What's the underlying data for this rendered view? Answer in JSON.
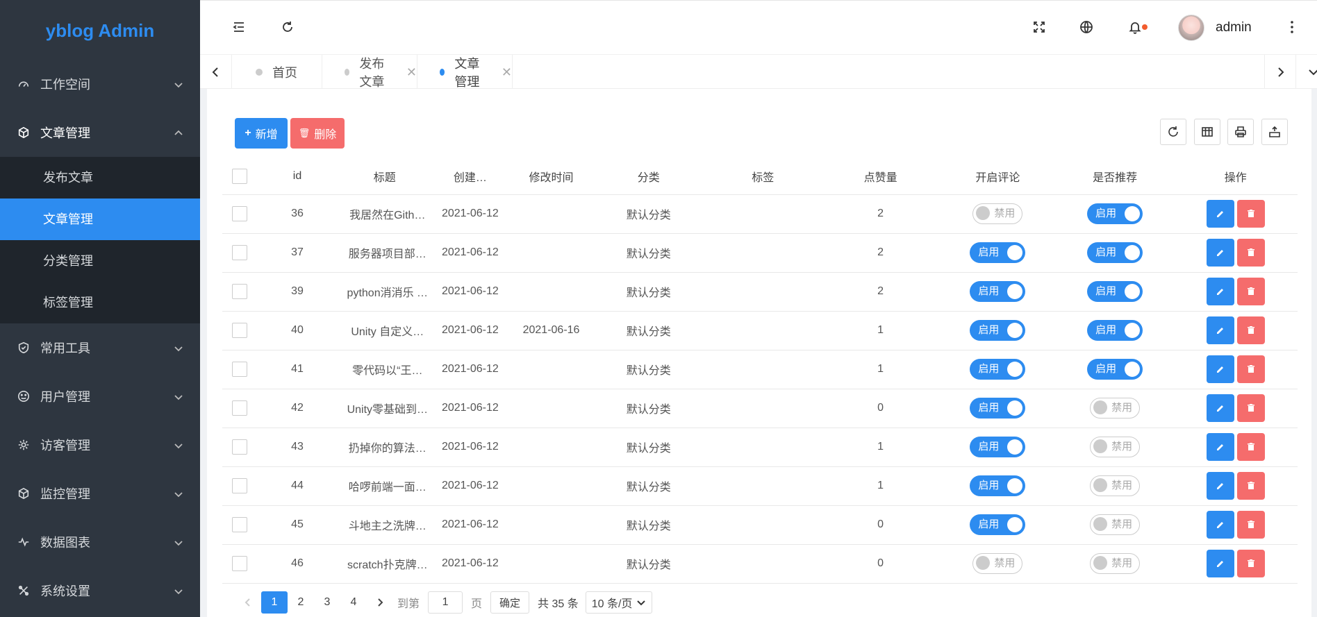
{
  "app": {
    "title": "yblog Admin"
  },
  "sidebar": {
    "items": [
      {
        "label": "工作空间",
        "icon": "dashboard-icon"
      },
      {
        "label": "文章管理",
        "icon": "cube-icon",
        "open": true,
        "children": [
          {
            "label": "发布文章"
          },
          {
            "label": "文章管理",
            "active": true
          },
          {
            "label": "分类管理"
          },
          {
            "label": "标签管理"
          }
        ]
      },
      {
        "label": "常用工具",
        "icon": "shield-check-icon"
      },
      {
        "label": "用户管理",
        "icon": "smile-icon"
      },
      {
        "label": "访客管理",
        "icon": "gear-icon"
      },
      {
        "label": "监控管理",
        "icon": "cube-icon"
      },
      {
        "label": "数据图表",
        "icon": "pulse-icon"
      },
      {
        "label": "系统设置",
        "icon": "tools-icon"
      }
    ]
  },
  "header": {
    "user": "admin",
    "has_notification": true
  },
  "tabs": [
    {
      "label": "首页",
      "closable": false
    },
    {
      "label": "发布文章",
      "closable": true
    },
    {
      "label": "文章管理",
      "closable": true,
      "active": true
    }
  ],
  "toolbar": {
    "add_label": "新增",
    "delete_label": "删除"
  },
  "table": {
    "columns": [
      "id",
      "标题",
      "创建…",
      "修改时间",
      "分类",
      "标签",
      "点赞量",
      "开启评论",
      "是否推荐",
      "操作"
    ],
    "rows": [
      {
        "id": "36",
        "title": "我居然在Gith…",
        "created": "2021-06-12",
        "modified": "",
        "category": "默认分类",
        "tags": "",
        "likes": "2",
        "comment": false,
        "recommend": true
      },
      {
        "id": "37",
        "title": "服务器项目部…",
        "created": "2021-06-12",
        "modified": "",
        "category": "默认分类",
        "tags": "",
        "likes": "2",
        "comment": true,
        "recommend": true
      },
      {
        "id": "39",
        "title": "python消消乐 …",
        "created": "2021-06-12",
        "modified": "",
        "category": "默认分类",
        "tags": "",
        "likes": "2",
        "comment": true,
        "recommend": true
      },
      {
        "id": "40",
        "title": "Unity 自定义…",
        "created": "2021-06-12",
        "modified": "2021-06-16",
        "category": "默认分类",
        "tags": "",
        "likes": "1",
        "comment": true,
        "recommend": true
      },
      {
        "id": "41",
        "title": "零代码以“王…",
        "created": "2021-06-12",
        "modified": "",
        "category": "默认分类",
        "tags": "",
        "likes": "1",
        "comment": true,
        "recommend": true
      },
      {
        "id": "42",
        "title": "Unity零基础到…",
        "created": "2021-06-12",
        "modified": "",
        "category": "默认分类",
        "tags": "",
        "likes": "0",
        "comment": true,
        "recommend": false
      },
      {
        "id": "43",
        "title": "扔掉你的算法…",
        "created": "2021-06-12",
        "modified": "",
        "category": "默认分类",
        "tags": "",
        "likes": "1",
        "comment": true,
        "recommend": false
      },
      {
        "id": "44",
        "title": "哈啰前端一面…",
        "created": "2021-06-12",
        "modified": "",
        "category": "默认分类",
        "tags": "",
        "likes": "1",
        "comment": true,
        "recommend": false
      },
      {
        "id": "45",
        "title": "斗地主之洗牌…",
        "created": "2021-06-12",
        "modified": "",
        "category": "默认分类",
        "tags": "",
        "likes": "0",
        "comment": true,
        "recommend": false
      },
      {
        "id": "46",
        "title": "scratch扑克牌…",
        "created": "2021-06-12",
        "modified": "",
        "category": "默认分类",
        "tags": "",
        "likes": "0",
        "comment": false,
        "recommend": false
      }
    ],
    "switch_on": "启用",
    "switch_off": "禁用"
  },
  "pagination": {
    "pages": [
      "1",
      "2",
      "3",
      "4"
    ],
    "current": "1",
    "goto_label": "到第",
    "goto_value": "1",
    "page_unit": "页",
    "confirm_label": "确定",
    "total_label": "共 35 条",
    "page_size": "10 条/页"
  },
  "colors": {
    "primary": "#2d8cf0",
    "danger": "#f56c6c",
    "sidebar_bg": "#2e3640",
    "submenu_bg": "#1f252c"
  }
}
